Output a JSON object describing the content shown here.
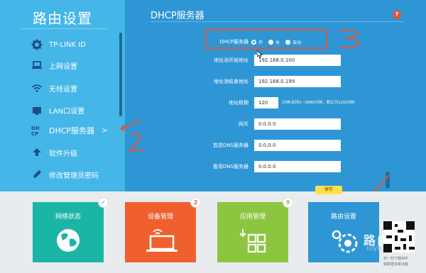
{
  "sidebar": {
    "title": "路由设置",
    "items": [
      {
        "label": "TP-LINK ID",
        "icon": "gear-icon"
      },
      {
        "label": "上网设置",
        "icon": "laptop-icon"
      },
      {
        "label": "无线设置",
        "icon": "wifi-icon"
      },
      {
        "label": "LAN口设置",
        "icon": "lan-port-icon"
      },
      {
        "label": "DHCP服务器",
        "icon": "dhcp-icon",
        "active": true,
        "arrow": ">"
      },
      {
        "label": "软件升级",
        "icon": "upload-icon"
      },
      {
        "label": "修改管理员密码",
        "icon": "pencil-icon"
      }
    ]
  },
  "content": {
    "title": "DHCP服务器",
    "help": "?",
    "dhcp_server": {
      "label": "DHCP服务器",
      "options": [
        "开",
        "关",
        "自动"
      ],
      "selected": "开"
    },
    "fields": [
      {
        "label": "地址池开始地址",
        "value": "192.168.0.100"
      },
      {
        "label": "地址池结束地址",
        "value": "192.168.0.199"
      },
      {
        "label": "地址租期",
        "value": "120",
        "hint": "分钟(支持1~2880分钟，默认为120分钟)"
      },
      {
        "label": "网关",
        "value": "0.0.0.0"
      },
      {
        "label": "首选DNS服务器",
        "value": "0.0.0.0"
      },
      {
        "label": "备用DNS服务器",
        "value": "0.0.0.0"
      }
    ]
  },
  "save_label": "保存",
  "tiles": [
    {
      "label": "网络状态",
      "color": "#1bb5a6",
      "badge": "✓",
      "icon": "globe-icon"
    },
    {
      "label": "设备管理",
      "color": "#f0602e",
      "badge": "2",
      "icon": "device-laptop-icon"
    },
    {
      "label": "应用管理",
      "color": "#8cc63f",
      "badge": "9",
      "icon": "apps-grid-icon"
    },
    {
      "label": "路由设置",
      "color": "#2e96d4",
      "icon": "router-settings-icon"
    }
  ],
  "watermark": {
    "cn": "路由器",
    "en": "luyouqi.com"
  },
  "qr": {
    "caption1": "扫一扫下载APP",
    "caption2": "获取更多新功能"
  },
  "annotations": {
    "mark1": "3",
    "mark2": "2"
  },
  "colors": {
    "sidebar_bg": "#44b6e8",
    "content_bg": "#2e96d4",
    "annotation_red": "#e0533b"
  }
}
